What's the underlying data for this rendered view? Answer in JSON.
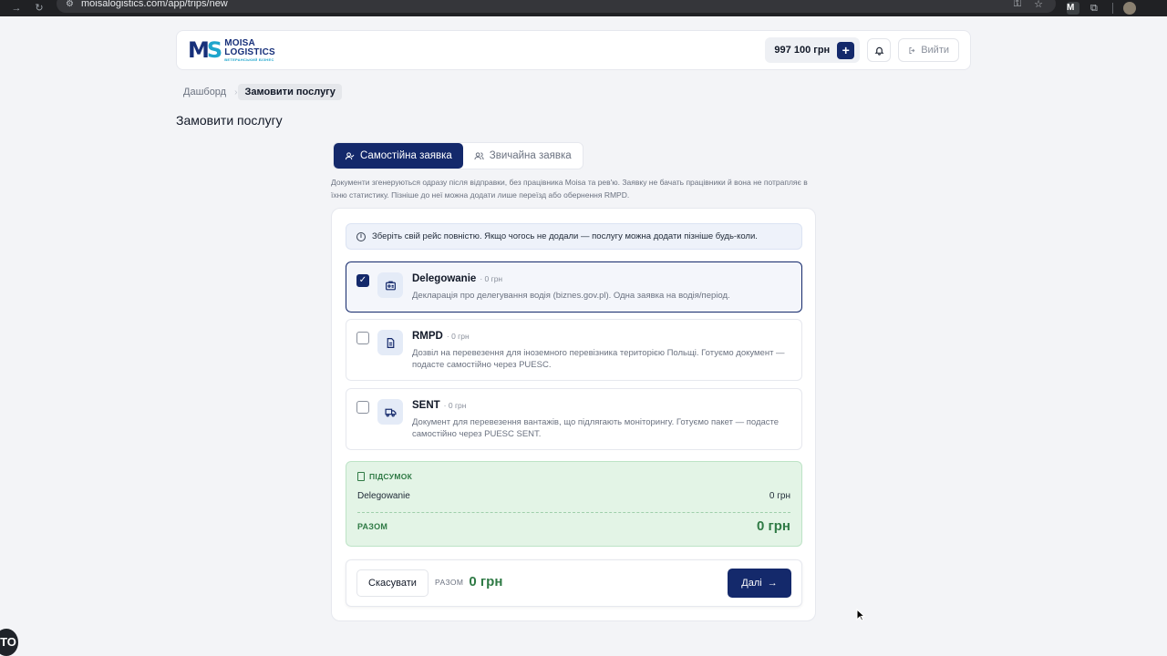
{
  "browser": {
    "url": "moisalogistics.com/app/trips/new",
    "ext_label": "M"
  },
  "header": {
    "logo": {
      "mark_m": "M",
      "mark_s": "S",
      "line1": "MOISA",
      "line2": "LOGISTICS",
      "line3": "ВЕТЕРАНСЬКИЙ БІЗНЕС"
    },
    "balance": "997 100 грн",
    "balance_add": "+",
    "logout_label": "Вийти"
  },
  "breadcrumb": {
    "home": "Дашборд",
    "current": "Замовити послугу"
  },
  "page_title": "Замовити послугу",
  "tabs": [
    {
      "label": "Самостійна заявка",
      "active": true,
      "icon": "user-check-icon"
    },
    {
      "label": "Звичайна заявка",
      "active": false,
      "icon": "users-icon"
    }
  ],
  "description": "Документи згенеруються одразу після відправки, без працівника Moisa та рев'ю. Заявку не бачать працівники й вона не потрапляє в їхню статистику. Пізніше до неї можна додати лише переїзд або обернення RMPD.",
  "info_banner": "Зберіть свій рейс повністю. Якщо чогось не додали — послугу можна додати пізніше будь-коли.",
  "services": [
    {
      "title": "Delegowanie",
      "price": "· 0 грн",
      "desc": "Декларація про делегування водія (biznes.gov.pl). Одна заявка на водія/період.",
      "checked": true,
      "icon": "id-card-icon"
    },
    {
      "title": "RMPD",
      "price": "· 0 грн",
      "desc": "Дозвіл на перевезення для іноземного перевізника територією Польщі. Готуємо документ — подасте самостійно через PUESC.",
      "checked": false,
      "icon": "document-icon"
    },
    {
      "title": "SENT",
      "price": "· 0 грн",
      "desc": "Документ для перевезення вантажів, що підлягають моніторингу. Готуємо пакет — подасте самостійно через PUESC SENT.",
      "checked": false,
      "icon": "truck-icon"
    }
  ],
  "summary": {
    "heading": "ПІДСУМОК",
    "items": [
      {
        "name": "Delegowanie",
        "price": "0 грн"
      }
    ],
    "total_label": "РАЗОМ",
    "total_value": "0 грн"
  },
  "footer": {
    "cancel_label": "Скасувати",
    "total_label": "РАЗОМ",
    "total_value": "0 грн",
    "next_label": "Далі"
  },
  "overlay": {
    "corner_badge": "ТО"
  },
  "colors": {
    "primary": "#14296b",
    "success": "#2f7a45",
    "success_bg": "#e3f4e6",
    "info_bg": "#eef2fa"
  }
}
